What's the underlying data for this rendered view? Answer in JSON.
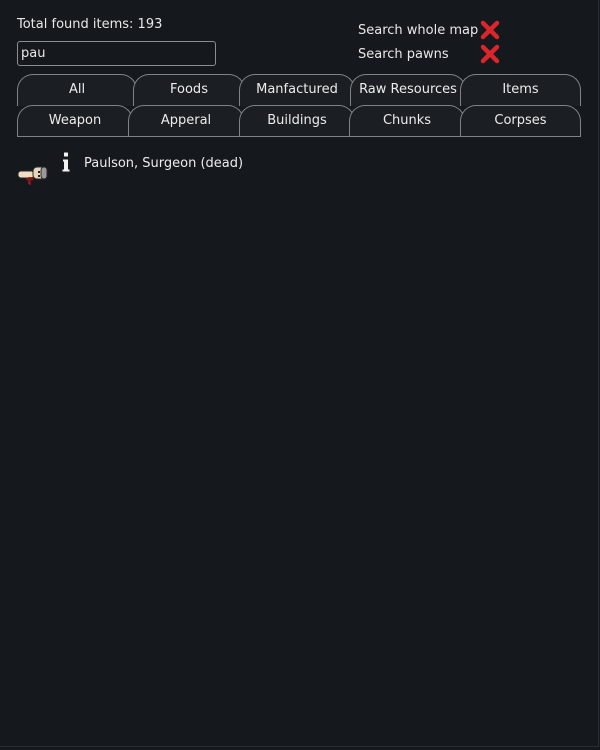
{
  "header": {
    "total_found_label": "Total found items: 193"
  },
  "search": {
    "value": "pau"
  },
  "options": {
    "whole_map_label": "Search whole map",
    "whole_map_icon": "red-x-icon",
    "pawns_label": "Search pawns",
    "pawns_icon": "red-x-icon"
  },
  "colors": {
    "background": "#15181d",
    "tab_border": "#7f8287",
    "cross_red": "#d9262b",
    "text": "#e8e8e8"
  },
  "tabs": {
    "row1": [
      "All",
      "Foods",
      "Manfactured",
      "Raw Resources",
      "Items"
    ],
    "row2": [
      "Weapon",
      "Apperal",
      "Buildings",
      "Chunks",
      "Corpses"
    ]
  },
  "results": [
    {
      "label": "Paulson, Surgeon (dead)",
      "thumbnail_icon": "pawn-corpse-icon",
      "info_icon": "info-icon"
    }
  ]
}
